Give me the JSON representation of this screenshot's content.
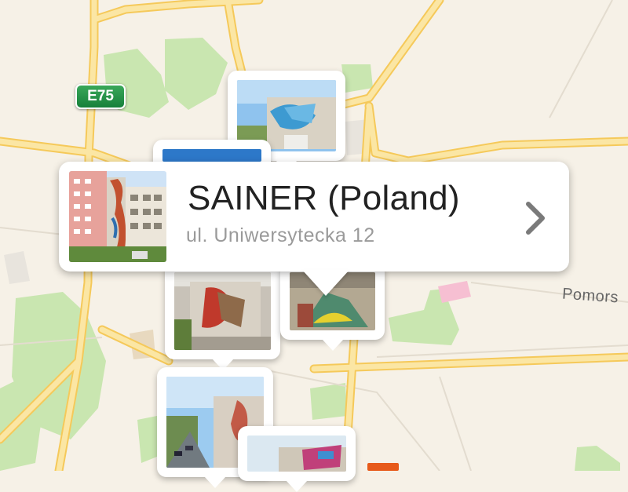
{
  "map": {
    "route_badge": "E75",
    "street_label": "Pomors"
  },
  "callout": {
    "title": "SAINER (Poland)",
    "address": "ul. Uniwersytecka 12",
    "chevron_icon": "chevron-right-icon"
  },
  "colors": {
    "land": "#f6f1e7",
    "park": "#c9e6b0",
    "road_major": "#f7d77e",
    "road_minor": "#e3dccf",
    "badge_green": "#1f8f45"
  }
}
